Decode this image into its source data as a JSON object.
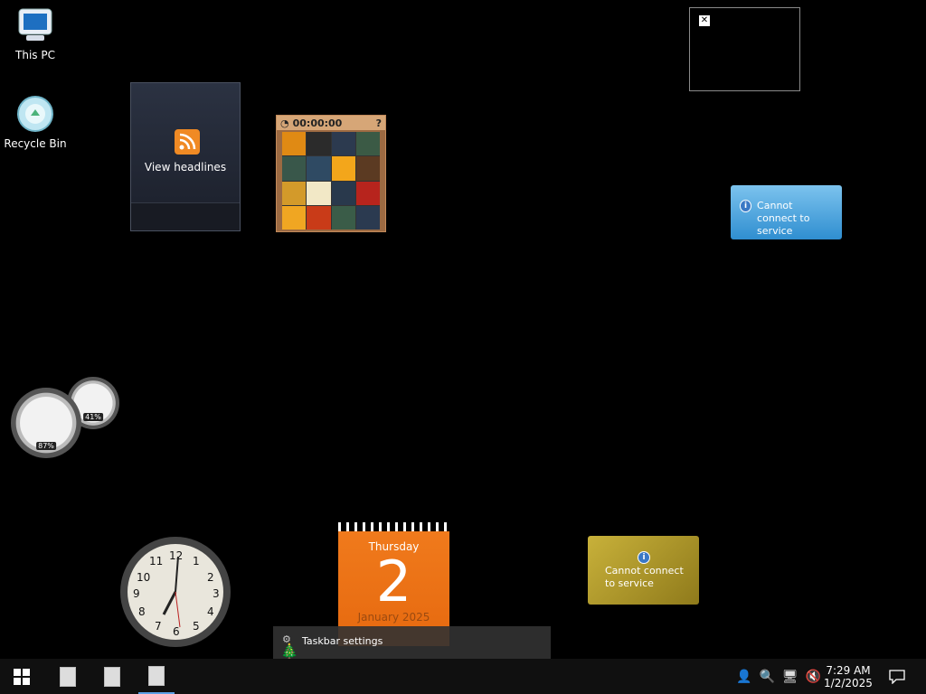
{
  "desktop": {
    "icons": [
      {
        "label": "This PC",
        "icon": "computer-icon"
      },
      {
        "label": "Recycle Bin",
        "icon": "recycle-bin-icon"
      }
    ]
  },
  "gadgets": {
    "feed": {
      "label": "View headlines",
      "icon": "rss-icon"
    },
    "puzzle": {
      "timer": "00:00:00"
    },
    "weather": {
      "message": "Cannot connect to service"
    },
    "currency": {
      "message": "Cannot connect to service"
    },
    "cpu_meter": {
      "cpu": "87%",
      "memory": "41%"
    },
    "clock": {
      "numbers": [
        "12",
        "1",
        "2",
        "3",
        "4",
        "5",
        "6",
        "7",
        "8",
        "9",
        "10",
        "11"
      ]
    },
    "calendar": {
      "weekday": "Thursday",
      "day": "2",
      "month_year": "January 2025"
    }
  },
  "popup": {
    "label": "Taskbar settings"
  },
  "taskbar": {
    "start_icon": "windows-logo-icon",
    "pinned": [
      "document-icon",
      "document-icon",
      "document-icon"
    ],
    "time": "7:29 AM",
    "date": "1/2/2025"
  }
}
